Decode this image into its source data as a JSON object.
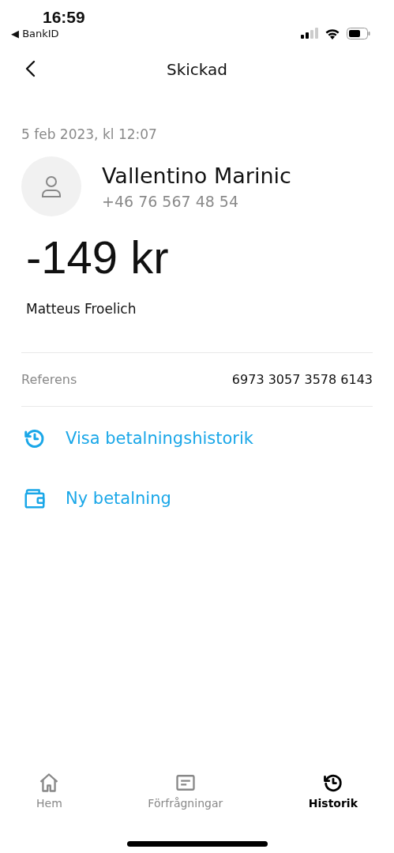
{
  "status_bar": {
    "time": "16:59",
    "back_app": "◀ BankID"
  },
  "header": {
    "title": "Skickad"
  },
  "payment": {
    "date": "5 feb 2023, kl 12:07",
    "recipient_name": "Vallentino Marinic",
    "recipient_phone": "+46 76 567 48 54",
    "amount": "-149 kr",
    "message": "Matteus Froelich"
  },
  "details": [
    {
      "label": "Referens",
      "value": "6973 3057 3578 6143"
    }
  ],
  "actions": [
    {
      "kind": "history",
      "label": "Visa betalningshistorik"
    },
    {
      "kind": "wallet",
      "label": "Ny betalning"
    }
  ],
  "tab_bar": [
    {
      "kind": "home",
      "label": "Hem",
      "selected": false
    },
    {
      "kind": "requests",
      "label": "Förfrågningar",
      "selected": false
    },
    {
      "kind": "history",
      "label": "Historik",
      "selected": true
    }
  ]
}
